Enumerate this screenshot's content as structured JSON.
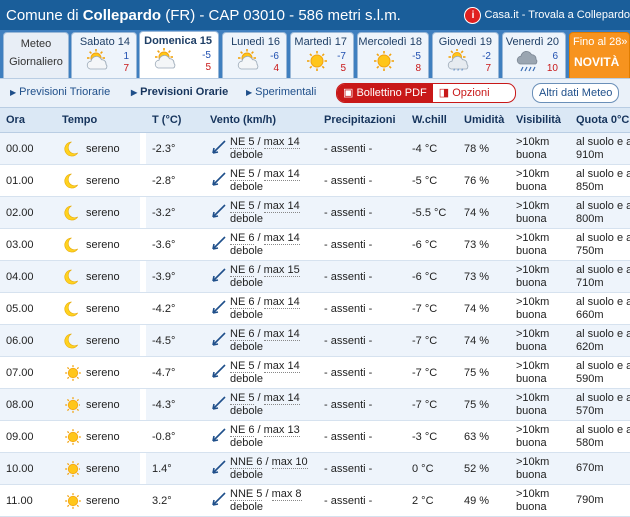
{
  "header": {
    "prefix": "Comune di ",
    "town": "Collepardo",
    "rest": " (FR) - CAP 03010 - 586 metri s.l.m.",
    "casa_label": "Casa.it - Trovala a Collepardo"
  },
  "tabs": [
    {
      "label": "Meteo Giornaliero",
      "kind": "meteo"
    },
    {
      "label": "Sabato 14",
      "min": "1",
      "max": "7",
      "icon": "cloud-sun-icon"
    },
    {
      "label": "Domenica 15",
      "min": "-5",
      "max": "5",
      "icon": "cloud-sun-icon",
      "active": true
    },
    {
      "label": "Lunedì 16",
      "min": "-6",
      "max": "4",
      "icon": "cloud-sun-icon"
    },
    {
      "label": "Martedì 17",
      "min": "-7",
      "max": "5",
      "icon": "sun-icon"
    },
    {
      "label": "Mercoledì 18",
      "min": "-5",
      "max": "8",
      "icon": "sun-icon"
    },
    {
      "label": "Giovedì 19",
      "min": "-2",
      "max": "7",
      "icon": "cloud-snow-icon"
    },
    {
      "label": "Venerdì 20",
      "min": "6",
      "max": "10",
      "icon": "cloud-rain-icon"
    },
    {
      "label": "Fino al 28»",
      "sub": "NOVITÀ",
      "kind": "orange"
    }
  ],
  "nav": {
    "triorarie": "Previsioni Triorarie",
    "orarie": "Previsioni Orarie",
    "sperimentali": "Sperimentali",
    "pdf": "Bollettino PDF",
    "opzioni": "Opzioni",
    "altri": "Altri dati Meteo"
  },
  "columns": [
    "Ora",
    "Tempo",
    "T (°C)",
    "Vento (km/h)",
    "Precipitazioni",
    "W.chill",
    "Umidità",
    "Visibilità",
    "Quota 0°C"
  ],
  "rows": [
    {
      "ora": "00.00",
      "icon": "moon-icon",
      "tempo": "sereno",
      "t": "-2.3°",
      "vento1": "NE 5",
      "vento2": "max 14",
      "vento3": "debole",
      "precip": "- assenti -",
      "wchill": "-4 °C",
      "umid": "78 %",
      "vis1": ">10km",
      "vis2": "buona",
      "quota1": "al suolo e a",
      "quota2": "910m"
    },
    {
      "ora": "01.00",
      "icon": "moon-icon",
      "tempo": "sereno",
      "t": "-2.8°",
      "vento1": "NE 5",
      "vento2": "max 14",
      "vento3": "debole",
      "precip": "- assenti -",
      "wchill": "-5 °C",
      "umid": "76 %",
      "vis1": ">10km",
      "vis2": "buona",
      "quota1": "al suolo e a",
      "quota2": "850m"
    },
    {
      "ora": "02.00",
      "icon": "moon-icon",
      "tempo": "sereno",
      "t": "-3.2°",
      "vento1": "NE 5",
      "vento2": "max 14",
      "vento3": "debole",
      "precip": "- assenti -",
      "wchill": "-5.5 °C",
      "umid": "74 %",
      "vis1": ">10km",
      "vis2": "buona",
      "quota1": "al suolo e a",
      "quota2": "800m"
    },
    {
      "ora": "03.00",
      "icon": "moon-icon",
      "tempo": "sereno",
      "t": "-3.6°",
      "vento1": "NE 6",
      "vento2": "max 14",
      "vento3": "debole",
      "precip": "- assenti -",
      "wchill": "-6 °C",
      "umid": "73 %",
      "vis1": ">10km",
      "vis2": "buona",
      "quota1": "al suolo e a",
      "quota2": "750m"
    },
    {
      "ora": "04.00",
      "icon": "moon-icon",
      "tempo": "sereno",
      "t": "-3.9°",
      "vento1": "NE 6",
      "vento2": "max 15",
      "vento3": "debole",
      "precip": "- assenti -",
      "wchill": "-6 °C",
      "umid": "73 %",
      "vis1": ">10km",
      "vis2": "buona",
      "quota1": "al suolo e a",
      "quota2": "710m"
    },
    {
      "ora": "05.00",
      "icon": "moon-icon",
      "tempo": "sereno",
      "t": "-4.2°",
      "vento1": "NE 6",
      "vento2": "max 14",
      "vento3": "debole",
      "precip": "- assenti -",
      "wchill": "-7 °C",
      "umid": "74 %",
      "vis1": ">10km",
      "vis2": "buona",
      "quota1": "al suolo e a",
      "quota2": "660m"
    },
    {
      "ora": "06.00",
      "icon": "moon-icon",
      "tempo": "sereno",
      "t": "-4.5°",
      "vento1": "NE 6",
      "vento2": "max 14",
      "vento3": "debole",
      "precip": "- assenti -",
      "wchill": "-7 °C",
      "umid": "74 %",
      "vis1": ">10km",
      "vis2": "buona",
      "quota1": "al suolo e a",
      "quota2": "620m"
    },
    {
      "ora": "07.00",
      "icon": "sun-icon",
      "tempo": "sereno",
      "t": "-4.7°",
      "vento1": "NE 5",
      "vento2": "max 14",
      "vento3": "debole",
      "precip": "- assenti -",
      "wchill": "-7 °C",
      "umid": "75 %",
      "vis1": ">10km",
      "vis2": "buona",
      "quota1": "al suolo e a",
      "quota2": "590m"
    },
    {
      "ora": "08.00",
      "icon": "sun-icon",
      "tempo": "sereno",
      "t": "-4.3°",
      "vento1": "NE 5",
      "vento2": "max 14",
      "vento3": "debole",
      "precip": "- assenti -",
      "wchill": "-7 °C",
      "umid": "75 %",
      "vis1": ">10km",
      "vis2": "buona",
      "quota1": "al suolo e a",
      "quota2": "570m"
    },
    {
      "ora": "09.00",
      "icon": "sun-icon",
      "tempo": "sereno",
      "t": "-0.8°",
      "vento1": "NE 6",
      "vento2": "max 13",
      "vento3": "debole",
      "precip": "- assenti -",
      "wchill": "-3 °C",
      "umid": "63 %",
      "vis1": ">10km",
      "vis2": "buona",
      "quota1": "al suolo e a",
      "quota2": "580m"
    },
    {
      "ora": "10.00",
      "icon": "sun-icon",
      "tempo": "sereno",
      "t": "1.4°",
      "vento1": "NNE 6",
      "vento2": "max 10",
      "vento3": "debole",
      "precip": "- assenti -",
      "wchill": "0 °C",
      "umid": "52 %",
      "vis1": ">10km",
      "vis2": "buona",
      "quota1": "670m",
      "quota2": ""
    },
    {
      "ora": "11.00",
      "icon": "sun-icon",
      "tempo": "sereno",
      "t": "3.2°",
      "vento1": "NNE 5",
      "vento2": "max 8",
      "vento3": "debole",
      "precip": "- assenti -",
      "wchill": "2 °C",
      "umid": "49 %",
      "vis1": ">10km",
      "vis2": "buona",
      "quota1": "790m",
      "quota2": ""
    }
  ],
  "colors": {
    "header_bg": "#1a5e9a",
    "tabs_bg": "#3f7fbf",
    "accent_red": "#c81818",
    "orange": "#f7931e",
    "row_alt": "#eef4fb"
  }
}
